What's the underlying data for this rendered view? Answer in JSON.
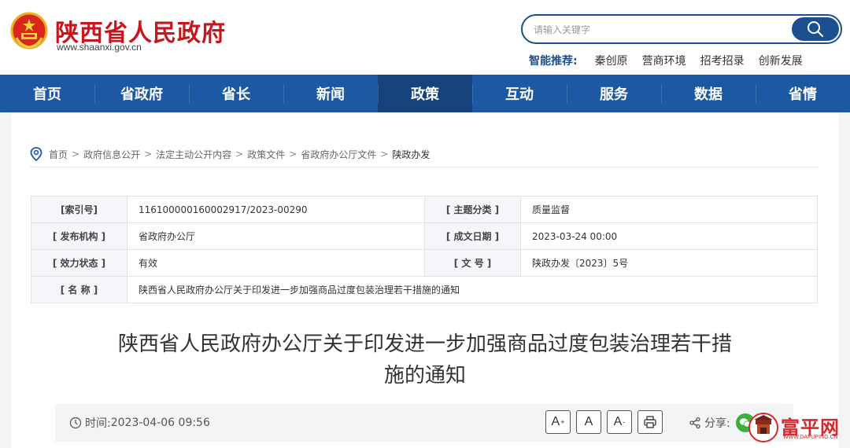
{
  "header": {
    "site_name": "陕西省人民政府",
    "site_url": "www.shaanxi.gov.cn",
    "search_placeholder": "请输入关键字",
    "recommend_label": "智能推荐:",
    "recommend_items": [
      "秦创原",
      "营商环境",
      "招考招录",
      "创新发展"
    ]
  },
  "nav": {
    "items": [
      "首页",
      "省政府",
      "省长",
      "新闻",
      "政策",
      "互动",
      "服务",
      "数据",
      "省情"
    ],
    "active_index": 4
  },
  "breadcrumb": {
    "items": [
      "首页",
      "政府信息公开",
      "法定主动公开内容",
      "政策文件",
      "省政府办公厅文件",
      "陕政办发"
    ],
    "separator": ">"
  },
  "meta": {
    "index_label": "[索引号]",
    "index_value": "116100000160002917/2023-00290",
    "topic_label": "[ 主题分类 ]",
    "topic_value": "质量监督",
    "publisher_label": "[ 发布机构 ]",
    "publisher_value": "省政府办公厅",
    "date_label": "[ 成文日期 ]",
    "date_value": "2023-03-24 00:00",
    "status_label": "[ 效力状态 ]",
    "status_value": "有效",
    "docno_label": "[ 文 号 ]",
    "docno_value": "陕政办发〔2023〕5号",
    "name_label": "[ 名 称 ]",
    "name_value": "陕西省人民政府办公厅关于印发进一步加强商品过度包装治理若干措施的通知"
  },
  "article": {
    "title_line1": "陕西省人民政府办公厅关于印发进一步加强商品过度包装治理若干措",
    "title_line2": "施的通知",
    "time_label": "时间:",
    "time_value": "2023-04-06 09:56",
    "font_large": "A",
    "font_large_sup": "+",
    "font_normal": "A",
    "font_small": "A",
    "font_small_sup": "-",
    "share_label": "分享:"
  },
  "watermark": {
    "text": "富平网",
    "url": "WWW.DAFUPING.CN"
  },
  "colors": {
    "brand_red": "#c8161d",
    "nav_blue": "#1d59a3",
    "nav_active": "#15427c",
    "search_blue": "#1b4f8f"
  }
}
